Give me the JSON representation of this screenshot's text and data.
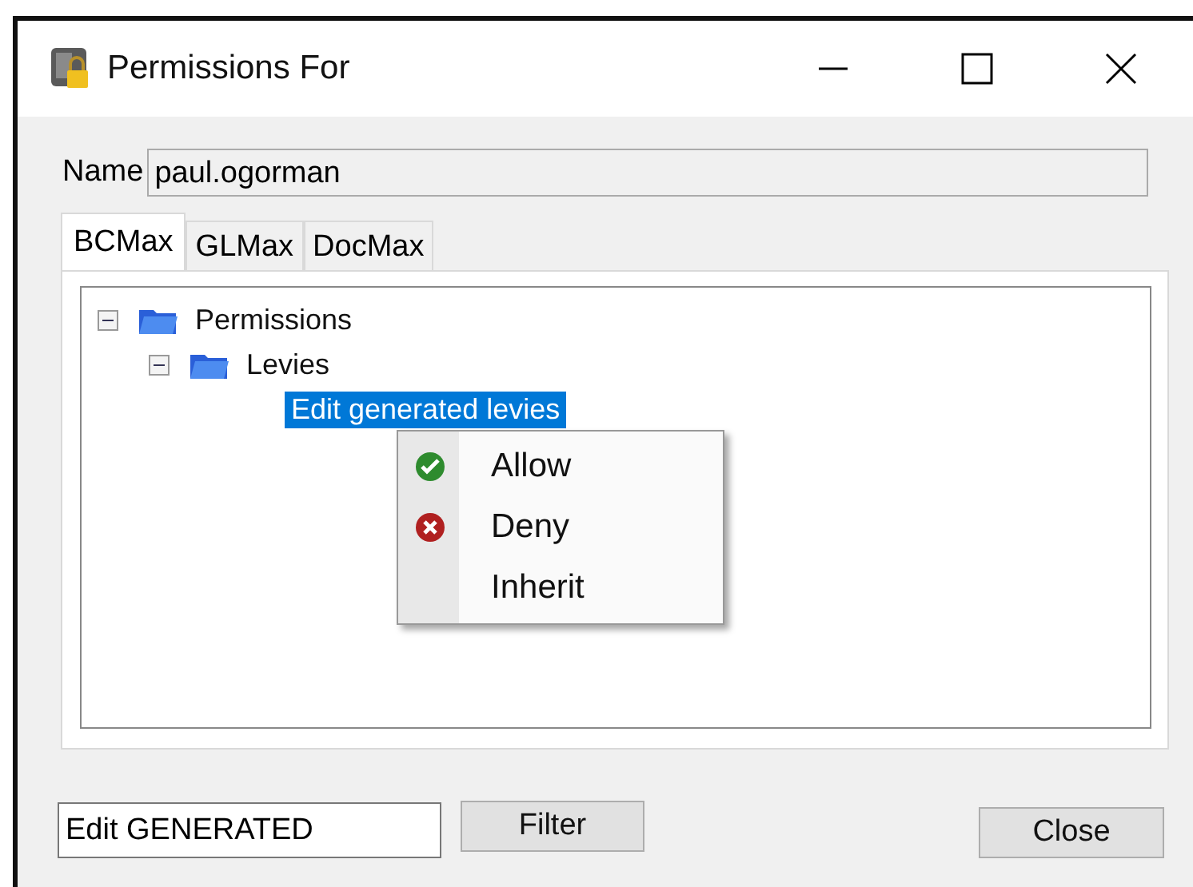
{
  "window": {
    "title": "Permissions For"
  },
  "name_field": {
    "label": "Name",
    "value": "paul.ogorman"
  },
  "tabs": [
    {
      "label": "BCMax",
      "selected": true
    },
    {
      "label": "GLMax",
      "selected": false
    },
    {
      "label": "DocMax",
      "selected": false
    }
  ],
  "tree": [
    {
      "label": "Permissions",
      "expanded": true,
      "selected": false,
      "children": [
        {
          "label": "Levies",
          "expanded": true,
          "selected": false,
          "children": [
            {
              "label": "Edit generated levies",
              "selected": true
            }
          ]
        }
      ]
    }
  ],
  "context_menu": [
    {
      "label": "Allow",
      "kind": "allow"
    },
    {
      "label": "Deny",
      "kind": "deny"
    },
    {
      "label": "Inherit",
      "kind": "plain"
    }
  ],
  "filter": {
    "value": "Edit GENERATED",
    "button": "Filter"
  },
  "buttons": [
    "Close"
  ]
}
